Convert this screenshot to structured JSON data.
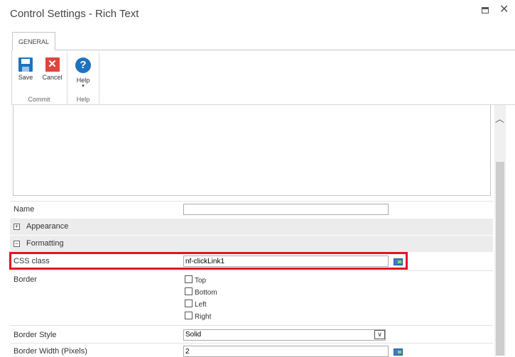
{
  "window": {
    "title": "Control Settings - Rich Text"
  },
  "ribbon": {
    "tab": "GENERAL",
    "groups": [
      {
        "label": "Commit",
        "buttons": [
          {
            "label": "Save"
          },
          {
            "label": "Cancel"
          }
        ]
      },
      {
        "label": "Help",
        "buttons": [
          {
            "label": "Help",
            "arrow": "▾"
          }
        ]
      }
    ]
  },
  "form": {
    "name": {
      "label": "Name",
      "value": ""
    },
    "appearance": {
      "label": "Appearance",
      "toggle": "+"
    },
    "formatting": {
      "label": "Formatting",
      "toggle": "−"
    },
    "css_class": {
      "label": "CSS class",
      "value": "nf-clickLink1"
    },
    "border": {
      "label": "Border",
      "options": [
        "Top",
        "Bottom",
        "Left",
        "Right"
      ]
    },
    "border_style": {
      "label": "Border Style",
      "value": "Solid"
    },
    "border_width": {
      "label": "Border Width (Pixels)",
      "value": "2"
    }
  },
  "colors": {
    "highlight": "#e5141f",
    "accent": "#1e73be"
  },
  "icons": [
    "maximize-icon",
    "close-icon",
    "save-icon",
    "cancel-icon",
    "help-icon",
    "scroll-up-icon",
    "lookup-icon",
    "chevron-down-icon"
  ]
}
